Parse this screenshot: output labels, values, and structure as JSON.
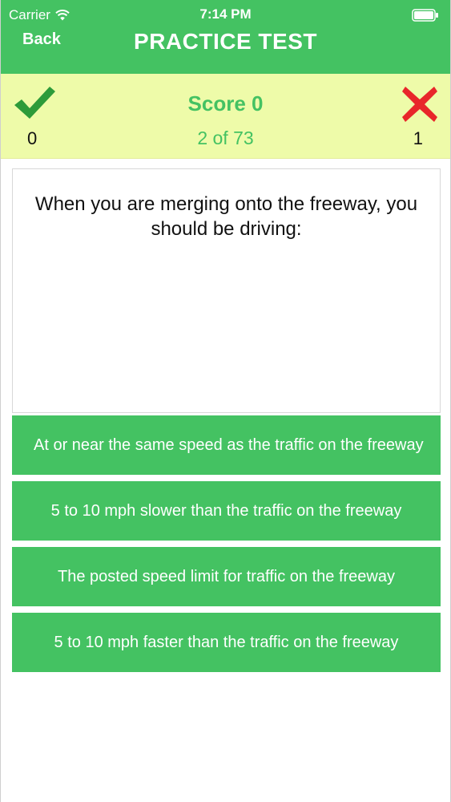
{
  "status_bar": {
    "carrier": "Carrier",
    "time": "7:14 PM"
  },
  "nav": {
    "back_label": "Back",
    "title": "PRACTICE TEST"
  },
  "score": {
    "correct_count": "0",
    "wrong_count": "1",
    "score_label": "Score 0",
    "progress_label": "2 of 73",
    "correct_icon": "checkmark-icon",
    "wrong_icon": "cross-icon"
  },
  "question": {
    "text": "When you are merging onto the freeway, you should be driving:"
  },
  "answers": [
    {
      "label": "At or near the same speed as the traffic on the freeway"
    },
    {
      "label": "5 to 10 mph slower than the traffic on the freeway"
    },
    {
      "label": "The posted speed limit for traffic on the freeway"
    },
    {
      "label": "5 to 10 mph faster than the traffic on the freeway"
    }
  ],
  "colors": {
    "primary_green": "#44c262",
    "score_panel_bg": "#eefba9",
    "check_green": "#2d9b3a",
    "cross_red": "#e8262a"
  }
}
